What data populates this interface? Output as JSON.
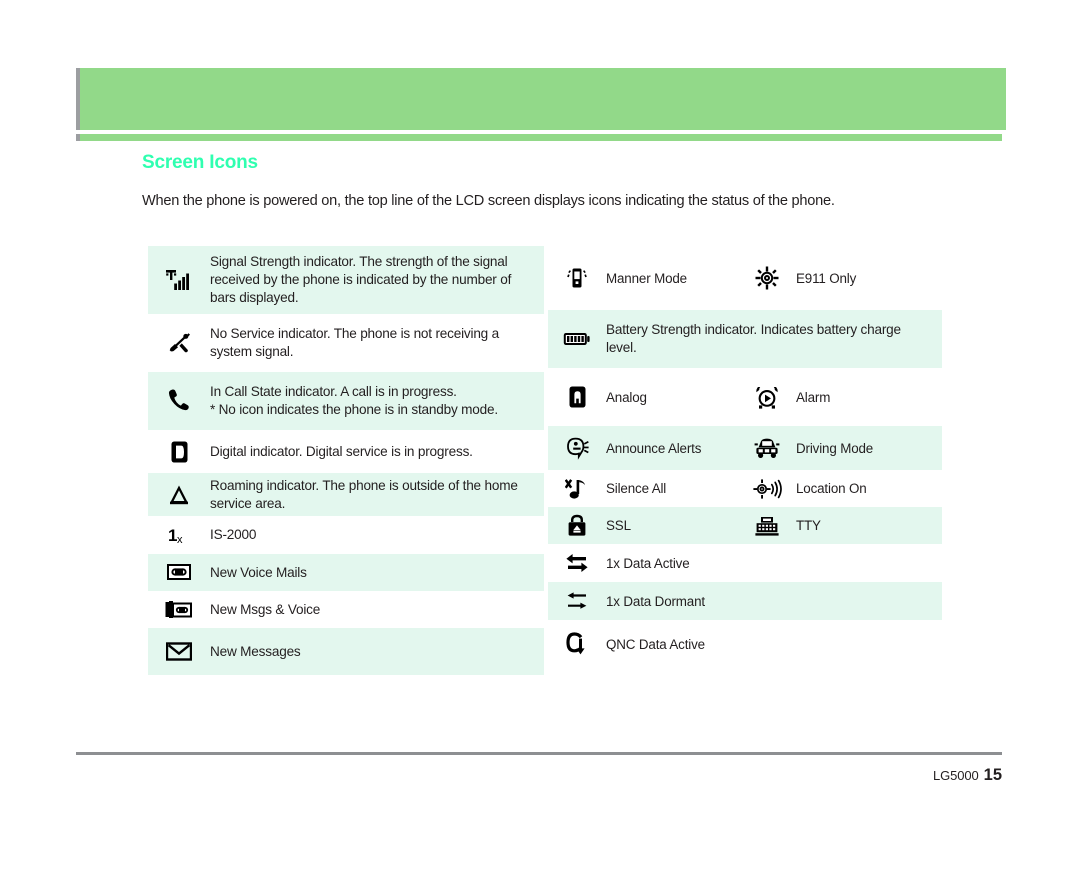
{
  "header": {
    "band_color": "#92d989",
    "rule_color": "#9c9ea1"
  },
  "page_title": "Screen Icons",
  "title_color": "#2fffb0",
  "intro_text": "When the phone is powered on, the top line of the LCD screen displays icons indicating the status of the phone.",
  "left_table": {
    "rows": [
      {
        "icon": "signal-strength-icon",
        "text": "Signal Strength indicator. The strength of the signal received by the phone is indicated by the number of bars displayed.",
        "shaded": true
      },
      {
        "icon": "no-service-icon",
        "text": "No Service indicator. The phone is not receiving a system signal.",
        "shaded": false
      },
      {
        "icon": "in-call-state-icon",
        "text": "In Call State indicator. A call is in progress.\n* No icon indicates the phone is in standby mode.",
        "shaded": true
      },
      {
        "icon": "digital-indicator-icon",
        "text": "Digital indicator. Digital service is in progress.",
        "shaded": false
      },
      {
        "icon": "roaming-icon",
        "text": "Roaming indicator. The phone is outside of the home service area.",
        "shaded": true
      },
      {
        "icon": "is2000-icon",
        "text": "IS-2000",
        "shaded": false
      },
      {
        "icon": "new-voice-mails-icon",
        "text": "New Voice Mails",
        "shaded": true
      },
      {
        "icon": "new-msgs-and-voice-icon",
        "text": "New Msgs & Voice",
        "shaded": false
      },
      {
        "icon": "new-messages-icon",
        "text": "New Messages",
        "shaded": true
      }
    ]
  },
  "right_table": {
    "rows": [
      {
        "type": "pair",
        "shaded": false,
        "icon_a": "manner-mode-icon",
        "label_a": "Manner Mode",
        "icon_b": "e911-only-icon",
        "label_b": "E911 Only"
      },
      {
        "type": "single",
        "shaded": true,
        "icon_a": "battery-strength-icon",
        "label_a": "Battery Strength indicator. Indicates battery charge level."
      },
      {
        "type": "pair",
        "shaded": false,
        "icon_a": "analog-icon",
        "label_a": "Analog",
        "icon_b": "alarm-icon",
        "label_b": "Alarm"
      },
      {
        "type": "pair",
        "shaded": true,
        "icon_a": "announce-alerts-icon",
        "label_a": "Announce Alerts",
        "icon_b": "driving-mode-icon",
        "label_b": "Driving Mode"
      },
      {
        "type": "pair",
        "shaded": false,
        "icon_a": "silence-all-icon",
        "label_a": "Silence All",
        "icon_b": "location-on-icon",
        "label_b": "Location On"
      },
      {
        "type": "pair",
        "shaded": true,
        "icon_a": "ssl-lock-icon",
        "label_a": "SSL",
        "icon_b": "tty-icon",
        "label_b": "TTY"
      },
      {
        "type": "single",
        "shaded": false,
        "icon_a": "1x-data-active-icon",
        "label_a": "1x Data Active"
      },
      {
        "type": "single",
        "shaded": true,
        "icon_a": "1x-data-dormant-icon",
        "label_a": "1x Data Dormant"
      },
      {
        "type": "single",
        "shaded": false,
        "icon_a": "qnc-data-active-icon",
        "label_a": "QNC Data Active"
      }
    ]
  },
  "footer": {
    "model": "LG5000",
    "page_number": "15",
    "rule_color": "#8d8f92"
  }
}
